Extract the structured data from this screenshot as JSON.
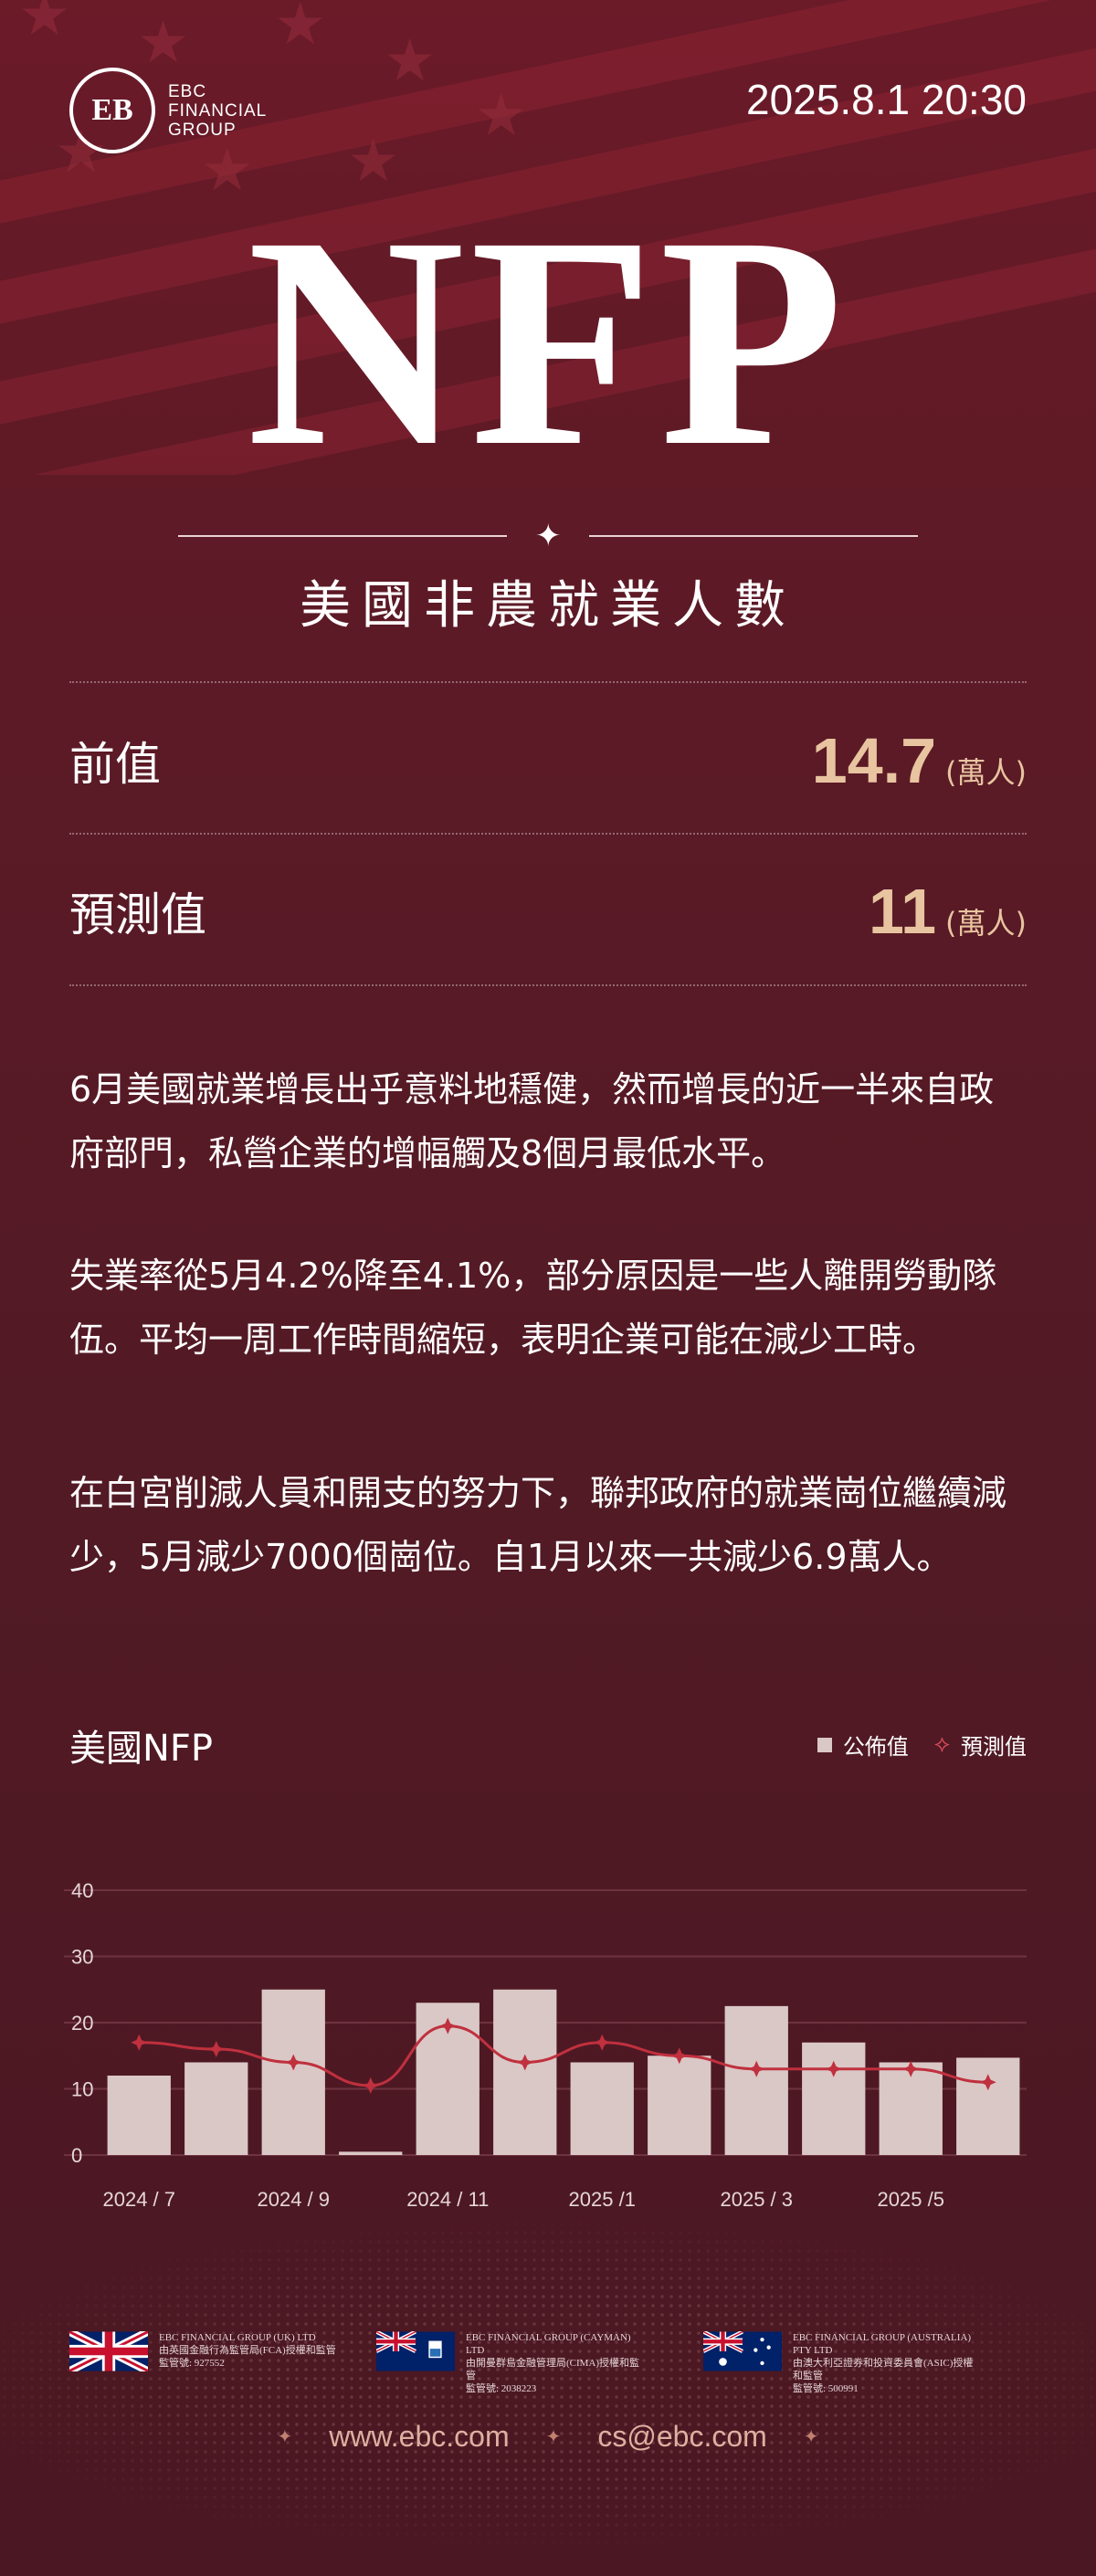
{
  "brand": {
    "mark": "EB",
    "line1": "EBC",
    "line2": "FINANCIAL",
    "line3": "GROUP"
  },
  "date": "2025.8.1 20:30",
  "hero": {
    "title": "NFP",
    "subtitle": "美國非農就業人數"
  },
  "metrics": [
    {
      "label": "前值",
      "value": "14.7",
      "unit": "(萬人)"
    },
    {
      "label": "預測值",
      "value": "11",
      "unit": "(萬人)"
    }
  ],
  "paragraphs": [
    "6月美國就業增長出乎意料地穩健，然而增長的近一半來自政府部門，私營企業的增幅觸及8個月最低水平。",
    "失業率從5月4.2%降至4.1%，部分原因是一些人離開勞動隊伍。平均一周工作時間縮短，表明企業可能在減少工時。",
    "在白宮削減人員和開支的努力下，聯邦政府的就業崗位繼續減少，5月減少7000個崗位。自1月以來一共減少6.9萬人。"
  ],
  "chart_data": {
    "type": "bar",
    "title": "美國NFP",
    "legend": {
      "actual": "公佈值",
      "forecast": "預測值",
      "placement": "top-right"
    },
    "categories": [
      "2024/7",
      "2024/8",
      "2024/9",
      "2024/10",
      "2024/11",
      "2024/12",
      "2025/1",
      "2025/2",
      "2025/3",
      "2025/4",
      "2025/5",
      "2025/6"
    ],
    "x_tick_labels": [
      "2024 / 7",
      "2024 / 9",
      "2024 / 11",
      "2025 /1",
      "2025 / 3",
      "2025 /5"
    ],
    "y_ticks": [
      "0",
      "10",
      "20",
      "30",
      "40"
    ],
    "ylim": [
      0,
      40
    ],
    "grid": true,
    "series": [
      {
        "name": "公佈值",
        "type": "bar",
        "values": [
          12,
          14,
          25,
          0.5,
          23,
          25,
          14,
          15,
          22.5,
          17,
          14,
          14.7
        ]
      },
      {
        "name": "預測值",
        "type": "line",
        "values": [
          17,
          16,
          14,
          10.5,
          19.5,
          14,
          17,
          15,
          13,
          13,
          13,
          11
        ]
      }
    ],
    "colors": {
      "bar": "#dac8c6",
      "line": "#c0303e",
      "grid": "#6e3340",
      "axis_text": "#e6d6d8"
    }
  },
  "regulators": [
    {
      "flag": "uk-flag-icon",
      "line1": "EBC FINANCIAL GROUP (UK) LTD",
      "line2": "由英國金融行為監管局(FCA)授權和監管",
      "line3": "監管號: 927552"
    },
    {
      "flag": "cayman-flag-icon",
      "line1": "EBC FINANCIAL GROUP (CAYMAN) LTD",
      "line2": "由開曼群島金融管理局(CIMA)授權和監管",
      "line3": "監管號: 2038223"
    },
    {
      "flag": "australia-flag-icon",
      "line1": "EBC FINANCIAL GROUP (AUSTRALIA) PTY LTD",
      "line2": "由澳大利亞證券和投資委員會(ASIC)授權和監管",
      "line3": "監管號: 500991"
    }
  ],
  "footer": {
    "website": "www.ebc.com",
    "email": "cs@ebc.com",
    "sep": "✦"
  }
}
